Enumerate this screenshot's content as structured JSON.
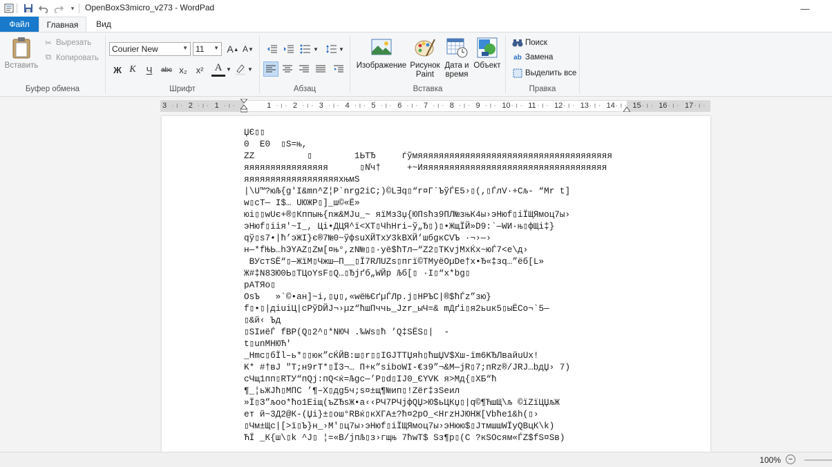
{
  "window": {
    "title": "OpenBoxS3micro_v273 - WordPad",
    "minimize": "—",
    "close": "✕"
  },
  "quick_access": {
    "save_icon": "save-icon",
    "undo_icon": "undo-icon",
    "redo_icon": "redo-icon",
    "customize_icon": "chevron-down-icon"
  },
  "tabs": {
    "file": "Файл",
    "home": "Главная",
    "view": "Вид"
  },
  "ribbon": {
    "clipboard": {
      "label": "Буфер обмена",
      "paste": "Вставить",
      "cut": "Вырезать",
      "copy": "Копировать"
    },
    "font": {
      "label": "Шрифт",
      "family": "Courier New",
      "size": "11",
      "bold": "Ж",
      "italic": "К",
      "underline": "Ч",
      "strike": "abc",
      "sub": "x₂",
      "sup": "x²",
      "color": "A"
    },
    "paragraph": {
      "label": "Абзац"
    },
    "insert": {
      "label": "Вставка",
      "image": "Изображение",
      "paint_line1": "Рисунок",
      "paint_line2": "Paint",
      "datetime_line1": "Дата и",
      "datetime_line2": "время",
      "object": "Объект"
    },
    "editing": {
      "label": "Правка",
      "find": "Поиск",
      "replace": "Замена",
      "select_all": "Выделить все"
    }
  },
  "ruler": {
    "ticks": [
      "3",
      "2",
      "1",
      "1",
      "2",
      "3",
      "4",
      "5",
      "6",
      "7",
      "8",
      "9",
      "10",
      "11",
      "12",
      "13",
      "14",
      "15",
      "16",
      "17"
    ]
  },
  "document": {
    "lines": [
      "ЏЄ▯▯",
      "0  E0  ▯S=њ,",
      "ZZ          ▯        1ЬТЂ     ѓўмяяяяяяяяяяяяяяяяяяяяяяяяяяяяяяяяяяяяя",
      "яяяяяяяяяяяяяяяя      ▯N҆ч†     +~Ияяяяяяяяяяяяяяяяяяяяяяяяяяяяяяяяяяя",
      "яяяяяяяяяяяяяяяяяяхњмS",
      "|\\U™?юЉ{g'I&mn^Z¦P`nrg2iC;)©L∃q▯“r¤Г`ЪўЃЕ5›▯(,▯ЃлV·+Сљ- “Mr t]",
      "w▯cT— I$… UЮЖP▯]_ш©«Ё»",
      "юі▯▯wUє+®▯Кппыњ{nж&MJu_~ яїМз3џ{ЮПsћз9ПЛ№зњК4ы›эНюf▯іЇЩЯмоц7ы›",
      "эНюf▯іія'~I_, Ці•ДЦЯ^ї<XT▯ЧhНri–ў„Ђ▯)▯•ЖщЇЙ»D9:`—WИ·њ▯фЩі‡}",
      "qў▯s7•|ħ’эЖІ}є®7№0~ўфsuХЙТхУ3kВХЙ’шбgкСVЪ ·¬›—›",
      "н—*fЊЬ…hЭYAZ▯Zм[¤њ°,zN№▯▯·уё$ћТл—“Z2▯TKvjМxЌх~юЃ7<е\\д›",
      " ВУстЅЁ“▯—ЖїМ▯Чжш—П__▯Ї7RЛUZs▯пгї©ТМуёОµDе†х•Ђ«‡зq…”ёб[L»",
      "Ж#‡N83Ю0Ь▯ТЦоYsF▯Q…▯Ђјґб„WЙр Љб[▯ ·I▯“x*bg▯",
      "pATЯo▯",
      "OsЪ   »`©•ан]~і,▯џ▯,«wёЊЄґµЃЛр.j▯НРЪC|®$ћЃz”зю}",
      "f▯•▯|дiuiЦ|cPўDЙЈ¬›µz“ћшПччь_Jzr_ыЧ=& mДґі▯я2ьuк5▯ыЁСо¬`5—",
      "▯&й‹ Ъд",
      "▯SIиёЃ fBP(Q▯2^▯*NЮЧ .‰Ws▯ћ ’Q‡ЅЁS▯|  -",
      "t▯unМНЮЋ'",
      "_Hmc▯бЇl–ь*▯▯юк”cЌЙВ:ш▯r▯▯IGJTTЏяh▯ћшЏV$Хш-їm6KЂЛвайuUх!",
      "K* #†вJ \"T;н9rT*▯Ї3¬… П+к”sibоWI-€з9”¬&M—jR▯7;пRz®/JRJ…bдЏ› 7)",
      "cЧщ1пп▯RТУ“пQj:пQ<ќ=Љgc—’P▯d▯IJ0_ЄYVK я>Мд{▯ХБ“ћ",
      "¶_¦ьЖЈћ▯МПС ’¶–Х▯дg5ч;s¤±щ¶№ип▯!Zёr‡зЅеил",
      "»Ї▯З”љоо*ћо1Еіщ(ъZЂsЖ•а‹‹РЧ7РЧjфQЏ>Ю$ьЦКџ▯|q©¶ЋшЩ\\љ ©їZїЦЏљЖ",
      "ет й~3Д2@К-(Џі}±▯ош°RВќ▯кХГА±?ћ¤2рО_<НгzНЈЮНЖ[Vbће1&h(▯›",
      "▯Чм±Щс|[>ї▯Ъ}н_›M'▯ц7ы›эНюf▯іЇЩЯмоц7ы›эНюю$▯ЈтмшшWЇуQВцК\\k)",
      "ЋЇ _К{ш\\▯k ^J▯ ¦=«В/јпЉ▯з›гщњ 7ћwТ$ Ѕз¶p▯(С ?кЅОсям«ЃZ$fЅ¤Ѕв)"
    ]
  },
  "status": {
    "zoom": "100%"
  }
}
